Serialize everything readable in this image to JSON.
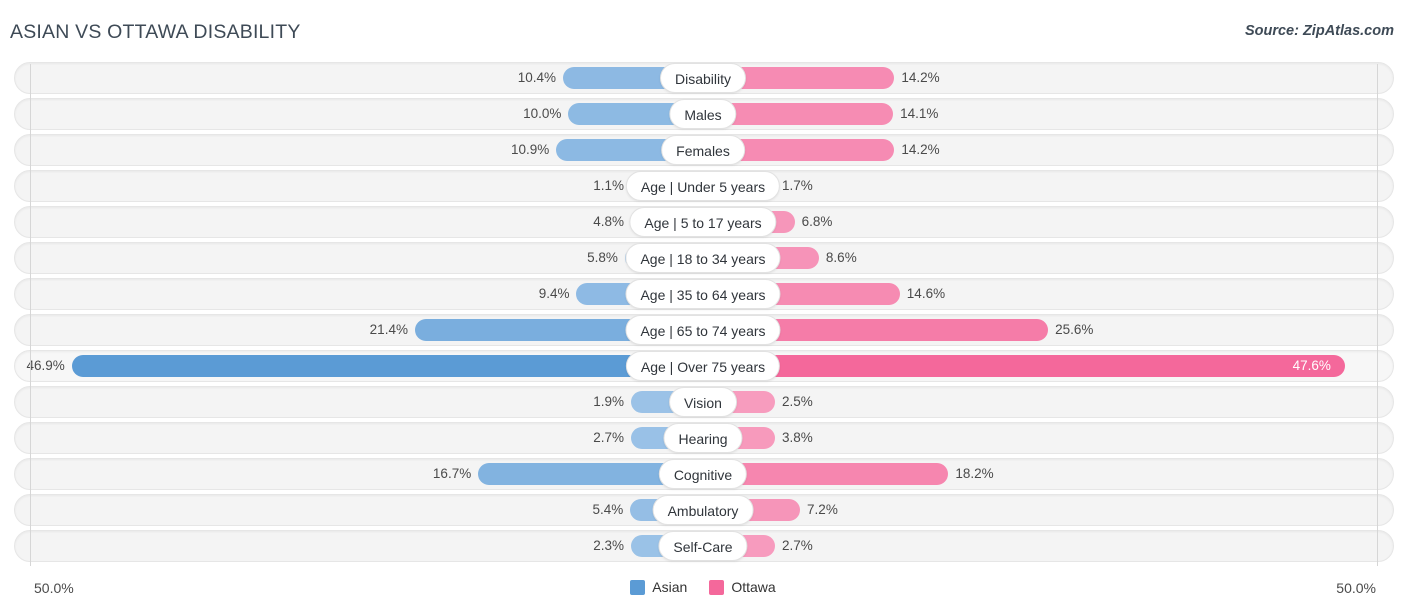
{
  "header": {
    "title": "ASIAN VS OTTAWA DISABILITY",
    "source": "Source: ZipAtlas.com"
  },
  "axis": {
    "left_label": "50.0%",
    "right_label": "50.0%",
    "max_percent": 50.0
  },
  "legend": {
    "items": [
      {
        "label": "Asian",
        "color": "#5b9bd5"
      },
      {
        "label": "Ottawa",
        "color": "#f4689b"
      }
    ]
  },
  "colors": {
    "asian_light": "#9ec4e8",
    "asian_mid": "#8ebae4",
    "asian_strong": "#5b9bd5",
    "ottawa_light": "#f79fc0",
    "ottawa_mid": "#f58cb0",
    "ottawa_strong": "#f4689b",
    "track": "#f4f4f4",
    "gridline": "#d6d6d6"
  },
  "chart_data": {
    "type": "bar",
    "subtype": "diverging-bar",
    "title": "ASIAN VS OTTAWA DISABILITY",
    "xlabel": "",
    "ylabel": "",
    "xlim": [
      -50.0,
      50.0
    ],
    "grid": true,
    "legend_position": "bottom-center",
    "unit": "%",
    "series": [
      {
        "name": "Asian",
        "side": "left",
        "color": "#5b9bd5",
        "values": [
          10.4,
          10.0,
          10.9,
          1.1,
          4.8,
          5.8,
          9.4,
          21.4,
          46.9,
          1.9,
          2.7,
          16.7,
          5.4,
          2.3
        ]
      },
      {
        "name": "Ottawa",
        "side": "right",
        "color": "#f4689b",
        "values": [
          14.2,
          14.1,
          14.2,
          1.7,
          6.8,
          8.6,
          14.6,
          25.6,
          47.6,
          2.5,
          3.8,
          18.2,
          7.2,
          2.7
        ]
      }
    ],
    "categories": [
      "Disability",
      "Males",
      "Females",
      "Age | Under 5 years",
      "Age | 5 to 17 years",
      "Age | 18 to 34 years",
      "Age | 35 to 64 years",
      "Age | 65 to 74 years",
      "Age | Over 75 years",
      "Vision",
      "Hearing",
      "Cognitive",
      "Ambulatory",
      "Self-Care"
    ]
  },
  "rows": [
    {
      "label": "Disability",
      "left_value": 10.4,
      "right_value": 14.2,
      "left_text": "10.4%",
      "right_text": "14.2%",
      "highlight": false
    },
    {
      "label": "Males",
      "left_value": 10.0,
      "right_value": 14.1,
      "left_text": "10.0%",
      "right_text": "14.1%",
      "highlight": false
    },
    {
      "label": "Females",
      "left_value": 10.9,
      "right_value": 14.2,
      "left_text": "10.9%",
      "right_text": "14.2%",
      "highlight": false
    },
    {
      "label": "Age | Under 5 years",
      "left_value": 1.1,
      "right_value": 1.7,
      "left_text": "1.1%",
      "right_text": "1.7%",
      "highlight": false
    },
    {
      "label": "Age | 5 to 17 years",
      "left_value": 4.8,
      "right_value": 6.8,
      "left_text": "4.8%",
      "right_text": "6.8%",
      "highlight": false
    },
    {
      "label": "Age | 18 to 34 years",
      "left_value": 5.8,
      "right_value": 8.6,
      "left_text": "5.8%",
      "right_text": "8.6%",
      "highlight": false
    },
    {
      "label": "Age | 35 to 64 years",
      "left_value": 9.4,
      "right_value": 14.6,
      "left_text": "9.4%",
      "right_text": "14.6%",
      "highlight": false
    },
    {
      "label": "Age | 65 to 74 years",
      "left_value": 21.4,
      "right_value": 25.6,
      "left_text": "21.4%",
      "right_text": "25.6%",
      "highlight": false
    },
    {
      "label": "Age | Over 75 years",
      "left_value": 46.9,
      "right_value": 47.6,
      "left_text": "46.9%",
      "right_text": "47.6%",
      "highlight": true
    },
    {
      "label": "Vision",
      "left_value": 1.9,
      "right_value": 2.5,
      "left_text": "1.9%",
      "right_text": "2.5%",
      "highlight": false
    },
    {
      "label": "Hearing",
      "left_value": 2.7,
      "right_value": 3.8,
      "left_text": "2.7%",
      "right_text": "3.8%",
      "highlight": false
    },
    {
      "label": "Cognitive",
      "left_value": 16.7,
      "right_value": 18.2,
      "left_text": "16.7%",
      "right_text": "18.2%",
      "highlight": false
    },
    {
      "label": "Ambulatory",
      "left_value": 5.4,
      "right_value": 7.2,
      "left_text": "5.4%",
      "right_text": "7.2%",
      "highlight": false
    },
    {
      "label": "Self-Care",
      "left_value": 2.3,
      "right_value": 2.7,
      "left_text": "2.3%",
      "right_text": "2.7%",
      "highlight": false
    }
  ]
}
